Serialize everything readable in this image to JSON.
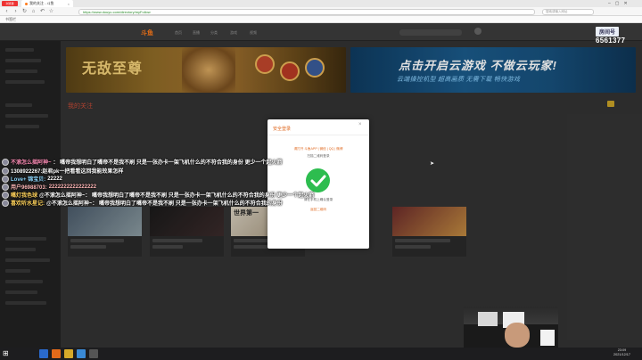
{
  "browser": {
    "logo_text": "浏览器",
    "tab_title": "我的关注 - 斗鱼",
    "url": "https://www.douyu.com/directory/myFollow",
    "bookmark_label": "书签栏",
    "search_placeholder": "搜索或输入网址"
  },
  "site": {
    "logo": "斗鱼",
    "nav": [
      "首页",
      "直播",
      "分类",
      "游戏",
      "视频"
    ],
    "section_title": "我的关注"
  },
  "banners": [
    {
      "title": "无敌至尊"
    },
    {
      "title": "点击开启云游戏 不做云玩家!",
      "subtitle": "云端操控机型 超高画质 无需下载 畅快游戏"
    }
  ],
  "card_tag": "世界第一",
  "modal": {
    "title": "安全登录",
    "close": "×",
    "hint": "请打开 斗鱼APP | 微信 | QQ | 微博",
    "sub": "扫描二维码登录",
    "scan_ok": "请在手机上确认登录",
    "switch": "返回二维码"
  },
  "chat": [
    {
      "name": "不滚怎么摇阿神~",
      "msg": "：   嘴帝我想明白了嘴帝不是我不刷 只是一张办卡一架飞机什么的不符合我的身份 更少一个起火箭"
    },
    {
      "name": "1308922267:赵君pk一把看看这回我能效果怎样",
      "msg": ""
    },
    {
      "name": "Love+ 锦宝贝:",
      "msg": "22222"
    },
    {
      "name": "用户96988703:",
      "msg": "2222222222222222"
    },
    {
      "name": "嘴灯我色球",
      "msg": "@不滚怎么摇阿神~：  嘴帝我想明白了嘴帝不是我不刷 只是一张办卡一架飞机什么的不符合我的身份 更少一个起火箭"
    },
    {
      "name": "喜欢听水星记:",
      "msg": "@不滚怎么摇阿神~：   嘴帝我想明白了嘴帝不是我不刷 只是一张办卡一架飞机什么的不符合我的身份"
    }
  ],
  "overlay": {
    "room_label": "房间号",
    "room_number": "6561377"
  },
  "clock": {
    "time": "23:09",
    "date": "2021/12/17"
  },
  "colors": {
    "accent": "#e06a21",
    "success": "#2dbd4f",
    "chat_name": "#b8a4ff"
  }
}
